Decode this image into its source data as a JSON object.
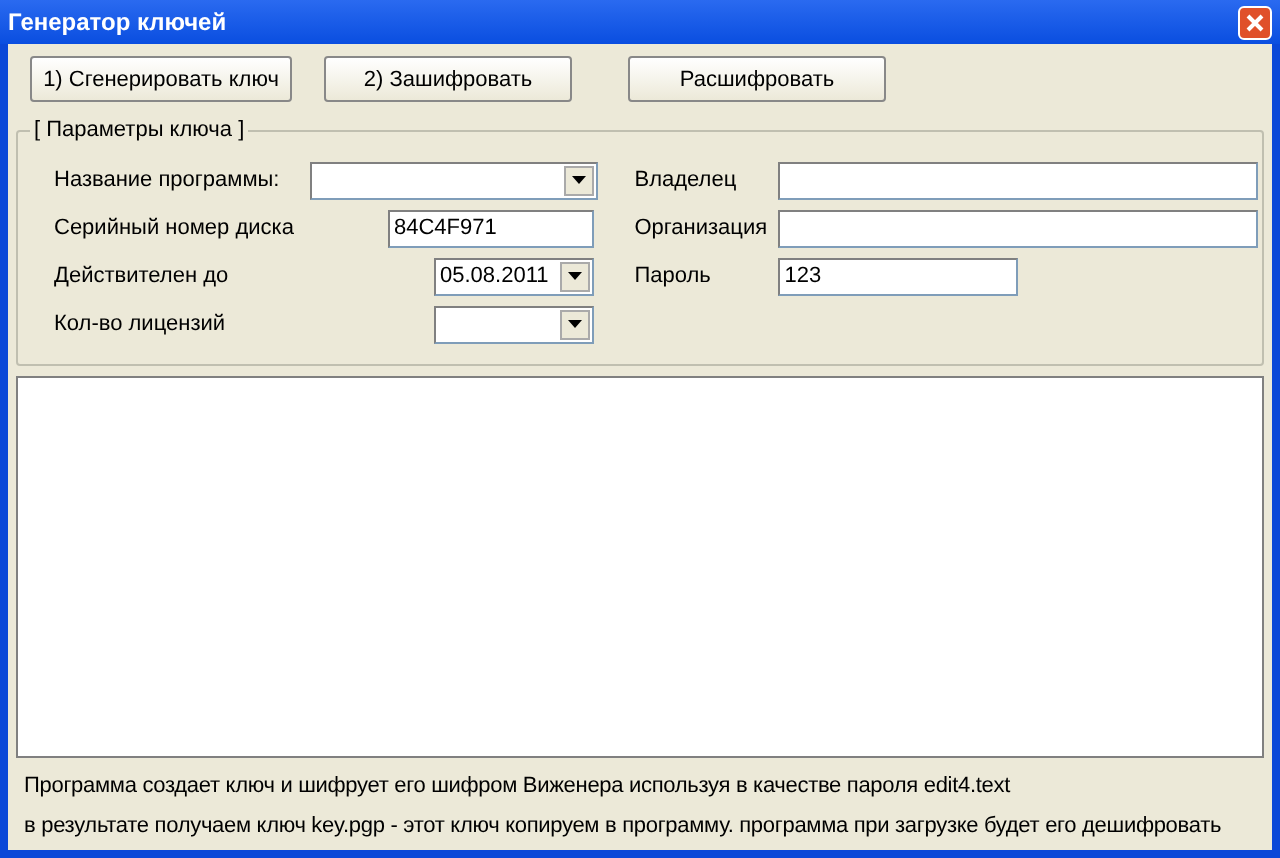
{
  "window": {
    "title": "Генератор ключей"
  },
  "buttons": [
    "1) Сгенерировать ключ",
    "2) Зашифровать",
    "Расшифровать"
  ],
  "group": {
    "title": "[ Параметры ключа ]",
    "left_fields": [
      {
        "kind": "combo",
        "label": "Название программы:"
      },
      {
        "kind": "text",
        "label": "Серийный номер диска",
        "value": "84C4F971"
      },
      {
        "kind": "combo",
        "label": "Действителен до",
        "value": "05.08.2011"
      },
      {
        "kind": "combo",
        "label": "Кол-во лицензий"
      }
    ],
    "right_fields": [
      {
        "label": "Владелец"
      },
      {
        "label": "Организация"
      },
      {
        "label": "Пароль",
        "value": "123"
      }
    ]
  },
  "notes": [
    "Программа создает ключ и шифрует его шифром Виженера используя в качестве пароля edit4.text",
    "в результате получаем ключ key.pgp - этот ключ копируем в программу. программа при загрузке будет его дешифровать"
  ]
}
